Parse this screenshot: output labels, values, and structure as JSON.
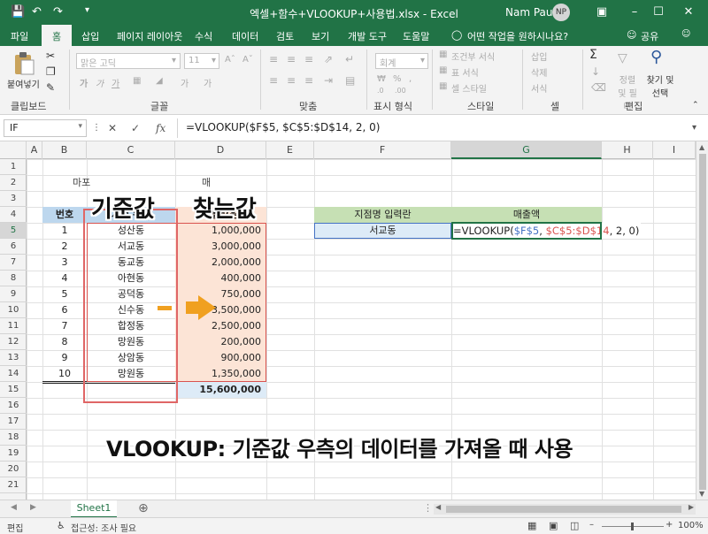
{
  "window": {
    "title": "엑셀+함수+VLOOKUP+사용법.xlsx  -  Excel",
    "user": "Nam Paul",
    "avatar_initials": "NP",
    "accent": "#217346"
  },
  "tabs": [
    "파일",
    "홈",
    "삽입",
    "페이지 레이아웃",
    "수식",
    "데이터",
    "검토",
    "보기",
    "개발 도구",
    "도움말"
  ],
  "tell_me": "어떤 작업을 원하시나요?",
  "share": "공유",
  "ribbon": {
    "paste": "붙여넣기",
    "clipboard": "클립보드",
    "font_name": "맑은 고딕",
    "font_size": "11",
    "font": "글꼴",
    "alignment": "맞춤",
    "number_format": "회계",
    "number": "표시 형식",
    "cond_format": "조건부 서식",
    "table_format": "표 서식",
    "cell_styles": "셀 스타일",
    "styles": "스타일",
    "insert": "삽입",
    "delete": "삭제",
    "format": "서식",
    "cells": "셀",
    "sort_filter": "정렬 및 필터",
    "find_select": "찾기 및 선택",
    "editing": "편집"
  },
  "formula_bar": {
    "name_box": "IF",
    "formula": "=VLOOKUP($F$5, $C$5:$D$14, 2, 0)"
  },
  "columns": [
    "A",
    "B",
    "C",
    "D",
    "E",
    "F",
    "G",
    "H",
    "I"
  ],
  "rows": [
    "1",
    "2",
    "3",
    "4",
    "5",
    "6",
    "7",
    "8",
    "9",
    "10",
    "11",
    "12",
    "13",
    "14",
    "15",
    "16",
    "17",
    "18",
    "19",
    "20",
    "21"
  ],
  "sheet": {
    "b2_text": "마포",
    "b2_text_end": "매",
    "table_headers": {
      "no": "번호",
      "branch": "지점 위치",
      "sales": "매출액(원)"
    },
    "table_rows": [
      {
        "no": "1",
        "branch": "성산동",
        "sales": "1,000,000"
      },
      {
        "no": "2",
        "branch": "서교동",
        "sales": "3,000,000"
      },
      {
        "no": "3",
        "branch": "동교동",
        "sales": "2,000,000"
      },
      {
        "no": "4",
        "branch": "아현동",
        "sales": "400,000"
      },
      {
        "no": "5",
        "branch": "공덕동",
        "sales": "750,000"
      },
      {
        "no": "6",
        "branch": "신수동",
        "sales": "3,500,000"
      },
      {
        "no": "7",
        "branch": "합정동",
        "sales": "2,500,000"
      },
      {
        "no": "8",
        "branch": "망원동",
        "sales": "200,000"
      },
      {
        "no": "9",
        "branch": "상암동",
        "sales": "900,000"
      },
      {
        "no": "10",
        "branch": "망원동",
        "sales": "1,350,000"
      }
    ],
    "total": "15,600,000",
    "lookup_headers": {
      "input": "지점명 입력란",
      "sales": "매출액"
    },
    "lookup_input": "서교동",
    "lookup_formula_parts": [
      "=VLOOKUP(",
      "$F$5",
      ", ",
      "$C$5:$D$14",
      ", 2, 0)"
    ]
  },
  "overlay": {
    "key_label": "기준값",
    "find_label": "찾는값",
    "caption": "VLOOKUP: 기준값 우측의 데이터를 가져올 때 사용"
  },
  "sheet_tabs": [
    "Sheet1"
  ],
  "status": {
    "mode": "편집",
    "accessibility": "접근성: 조사 필요",
    "zoom": "100%"
  }
}
